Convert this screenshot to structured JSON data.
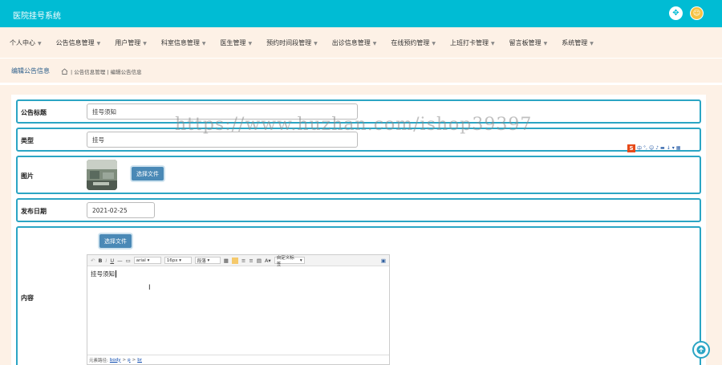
{
  "app": {
    "title": "医院挂号系统"
  },
  "nav": {
    "items": [
      {
        "label": "个人中心"
      },
      {
        "label": "公告信息管理"
      },
      {
        "label": "用户管理"
      },
      {
        "label": "科室信息管理"
      },
      {
        "label": "医生管理"
      },
      {
        "label": "预约时间段管理"
      },
      {
        "label": "出诊信息管理"
      },
      {
        "label": "在线预约管理"
      },
      {
        "label": "上班打卡管理"
      },
      {
        "label": "留言板管理"
      },
      {
        "label": "系统管理"
      }
    ]
  },
  "breadcrumb": {
    "title": "编辑公告信息",
    "path": "| 公告信息管理 | 编辑公告信息"
  },
  "form": {
    "title_label": "公告标题",
    "title_value": "挂号须知",
    "type_label": "类型",
    "type_value": "挂号",
    "image_label": "图片",
    "choose_file_label": "选择文件",
    "date_label": "发布日期",
    "date_value": "2021-02-25",
    "content_label": "内容",
    "content_choose_file_label": "选择文件"
  },
  "editor": {
    "font_family": "arial",
    "font_size": "16px",
    "paragraph": "段落",
    "custom_label": "自定义标签",
    "body_text": "挂号须知",
    "status_prefix": "元素路径:",
    "status_path": [
      "body",
      "p",
      "br"
    ]
  },
  "watermark": {
    "text": "https://www.huzhan.com/ishop39397"
  },
  "ime": {
    "logo": "S",
    "lang": "中"
  },
  "colors": {
    "topbar": "#00bcd4",
    "nav_bg": "#fdf1e6",
    "row_border": "#2ba5c4",
    "button": "#4a89b6"
  }
}
